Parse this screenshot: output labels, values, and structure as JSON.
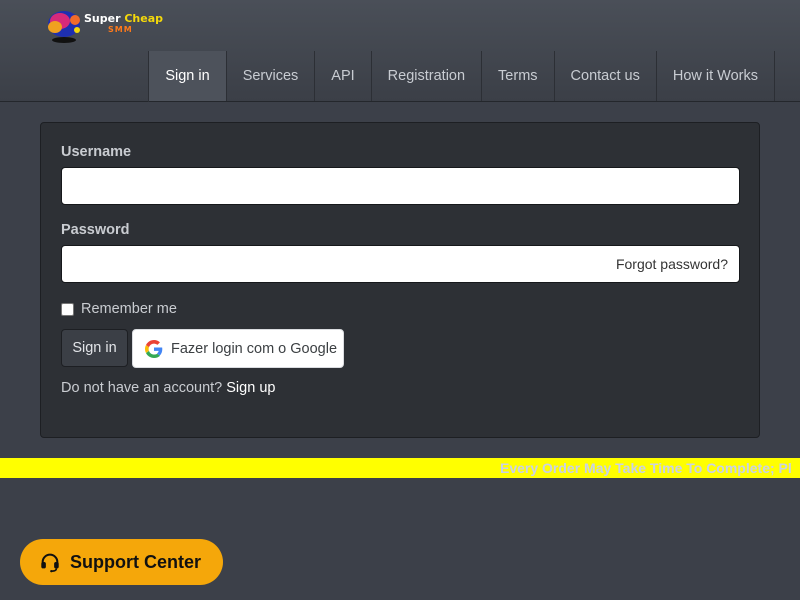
{
  "header": {
    "logo": {
      "word1": "Super",
      "word2": "Cheap",
      "word3": "SMM"
    },
    "nav": [
      {
        "label": "Sign in",
        "active": true
      },
      {
        "label": "Services"
      },
      {
        "label": "API"
      },
      {
        "label": "Registration"
      },
      {
        "label": "Terms"
      },
      {
        "label": "Contact us"
      },
      {
        "label": "How it Works"
      }
    ]
  },
  "form": {
    "username_label": "Username",
    "username_value": "",
    "password_label": "Password",
    "password_value": "",
    "forgot_link": "Forgot password?",
    "remember_label": "Remember me",
    "remember_checked": false,
    "signin_button": "Sign in",
    "google_button": "Fazer login com o Google",
    "no_account_text": "Do not have an account?",
    "signup_link": "Sign up"
  },
  "ticker": {
    "text": "Every Order May Take Time To Complete; Pl"
  },
  "support": {
    "label": "Support Center",
    "icon": "headset-icon"
  },
  "colors": {
    "background": "#3c4049",
    "card": "#2d3035",
    "ticker_bg": "#ffff00",
    "support_bg": "#f5a70a",
    "logo_cheap": "#f5d90a",
    "logo_smm": "#ff7a1a"
  }
}
